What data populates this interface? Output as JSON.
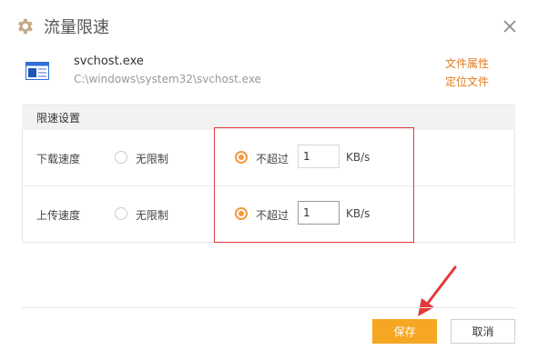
{
  "dialog": {
    "title": "流量限速"
  },
  "file": {
    "name": "svchost.exe",
    "path": "C:\\windows\\system32\\svchost.exe",
    "properties_link": "文件属性",
    "locate_link": "定位文件"
  },
  "limits": {
    "section_title": "限速设置",
    "download": {
      "label": "下载速度",
      "unlimited_label": "无限制",
      "limit_label": "不超过",
      "value": "1",
      "unit": "KB/s",
      "selected": "limit"
    },
    "upload": {
      "label": "上传速度",
      "unlimited_label": "无限制",
      "limit_label": "不超过",
      "value": "1",
      "unit": "KB/s",
      "selected": "limit"
    }
  },
  "footer": {
    "save_label": "保存",
    "cancel_label": "取消"
  },
  "colors": {
    "accent": "#f5a623",
    "link": "#e07c1f",
    "highlight": "#e23a3a"
  }
}
